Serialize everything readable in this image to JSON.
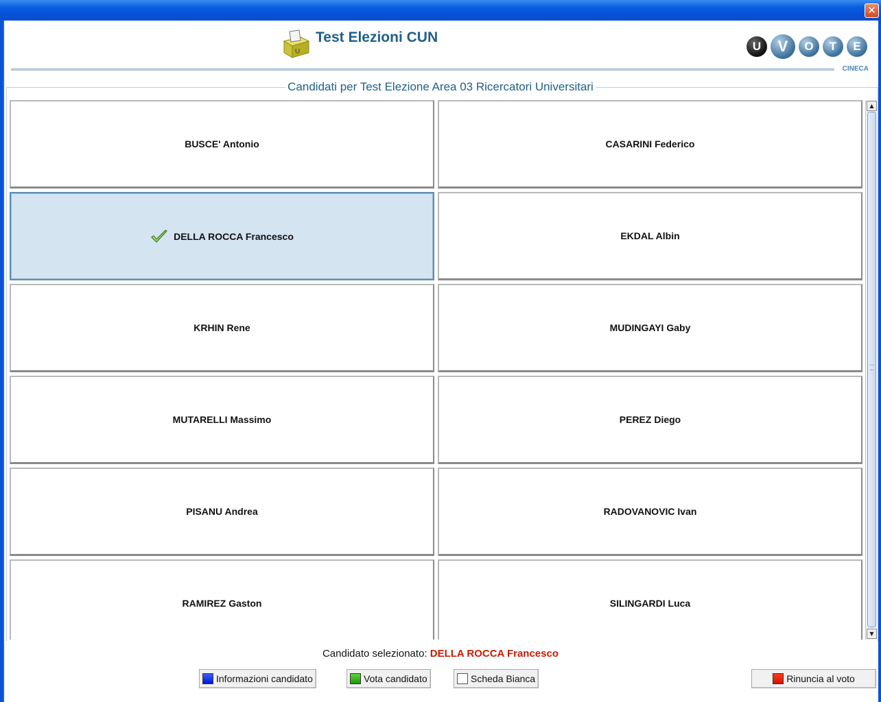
{
  "window": {
    "close_glyph": "✕"
  },
  "header": {
    "title": "Test Elezioni CUN",
    "logo_icon": "ballot-box-icon",
    "brand_letters": [
      "U",
      "V",
      "O",
      "T",
      "E"
    ],
    "brand_sub": "CINECA"
  },
  "panel": {
    "title": "Candidati per Test Elezione Area 03 Ricercatori Universitari"
  },
  "candidates": [
    {
      "name": "BUSCE' Antonio",
      "selected": false
    },
    {
      "name": "CASARINI Federico",
      "selected": false
    },
    {
      "name": "DELLA ROCCA Francesco",
      "selected": true
    },
    {
      "name": "EKDAL Albin",
      "selected": false
    },
    {
      "name": "KRHIN Rene",
      "selected": false
    },
    {
      "name": "MUDINGAYI Gaby",
      "selected": false
    },
    {
      "name": "MUTARELLI Massimo",
      "selected": false
    },
    {
      "name": "PEREZ Diego",
      "selected": false
    },
    {
      "name": "PISANU Andrea",
      "selected": false
    },
    {
      "name": "RADOVANOVIC Ivan",
      "selected": false
    },
    {
      "name": "RAMIREZ Gaston",
      "selected": false
    },
    {
      "name": "SILINGARDI Luca",
      "selected": false
    }
  ],
  "footer": {
    "selected_label": "Candidato selezionato:",
    "selected_name": "DELLA ROCCA Francesco",
    "buttons": {
      "info": "Informazioni candidato",
      "vote": "Vota candidato",
      "blank": "Scheda Bianca",
      "renounce": "Rinuncia al voto"
    }
  },
  "colors": {
    "accent": "#1f5f8a",
    "selected_bg": "#d4e4f1",
    "selected_name": "#cc1a00"
  }
}
